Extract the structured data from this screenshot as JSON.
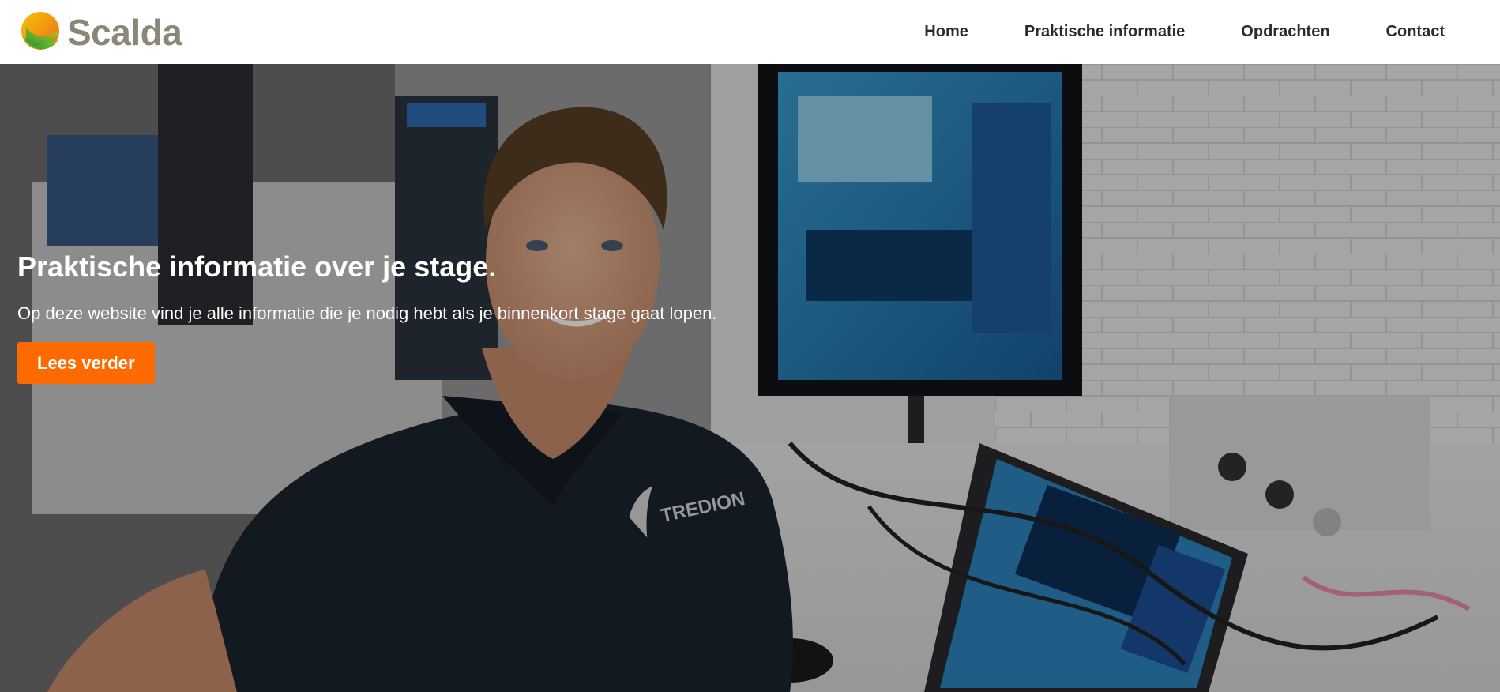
{
  "brand": {
    "name": "Scalda",
    "colors": {
      "logo_text": "#8a8778",
      "accent_orange": "#ff6a00",
      "logo_green": "#5aab2f",
      "logo_yellow": "#f2b705"
    }
  },
  "nav": {
    "items": [
      {
        "label": "Home"
      },
      {
        "label": "Praktische informatie"
      },
      {
        "label": "Opdrachten"
      },
      {
        "label": "Contact"
      }
    ]
  },
  "hero": {
    "title": "Praktische informatie over je stage.",
    "text": "Op deze website vind je alle informatie die je nodig hebt als je binnenkort stage gaat lopen.",
    "button_label": "Lees verder",
    "shirt_logo_text": "TREDION"
  }
}
